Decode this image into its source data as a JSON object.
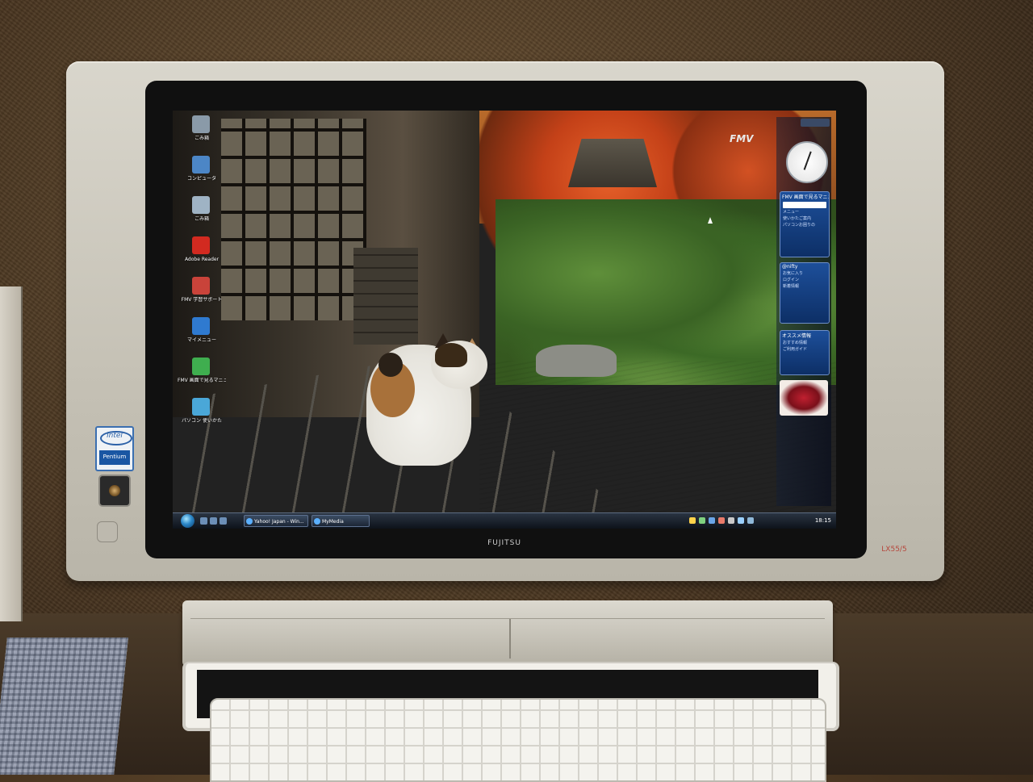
{
  "scene": {
    "brand_text": "FUJITSU",
    "badge_intel": "intel",
    "badge_pentium": "Pentium",
    "model_badge": "LX55/5"
  },
  "desktop": {
    "fmv_logo": "FMV",
    "icons": [
      {
        "label": "ごみ箱",
        "icon": "recycle-bin-icon",
        "color": "#8a9aa8"
      },
      {
        "label": "コンピュータ",
        "icon": "computer-icon",
        "color": "#4c86c6"
      },
      {
        "label": "ごみ箱",
        "icon": "trash-icon",
        "color": "#9fb3c4"
      },
      {
        "label": "Adobe Reader",
        "icon": "adobe-reader-icon",
        "color": "#d22a20"
      },
      {
        "label": "FMV 学習サポート",
        "icon": "support-icon",
        "color": "#c9433a"
      },
      {
        "label": "マイメニュー",
        "icon": "menu-icon",
        "color": "#2f7ad0"
      },
      {
        "label": "FMV 画面で見るマニュアル",
        "icon": "manual-icon",
        "color": "#3fae4f"
      },
      {
        "label": "パソコン 使いかた",
        "icon": "guide-icon",
        "color": "#4aa7d8"
      }
    ]
  },
  "sidebar": {
    "gadgets": [
      {
        "title": "FMV 画面で見るマニュアル",
        "lines": [
          "メニュー",
          "使いかたご案内",
          "パソコンお困りの"
        ]
      },
      {
        "title": "@nifty",
        "lines": [
          "お気に入り",
          "ログイン",
          "新着情報"
        ]
      },
      {
        "title": "オススメ情報",
        "lines": [
          "おすすめ情報",
          "ご利用ガイド"
        ]
      }
    ]
  },
  "taskbar": {
    "buttons": [
      {
        "label": "Yahoo! Japan - Win..."
      },
      {
        "label": "MyMedia"
      }
    ],
    "time": "18:15"
  }
}
